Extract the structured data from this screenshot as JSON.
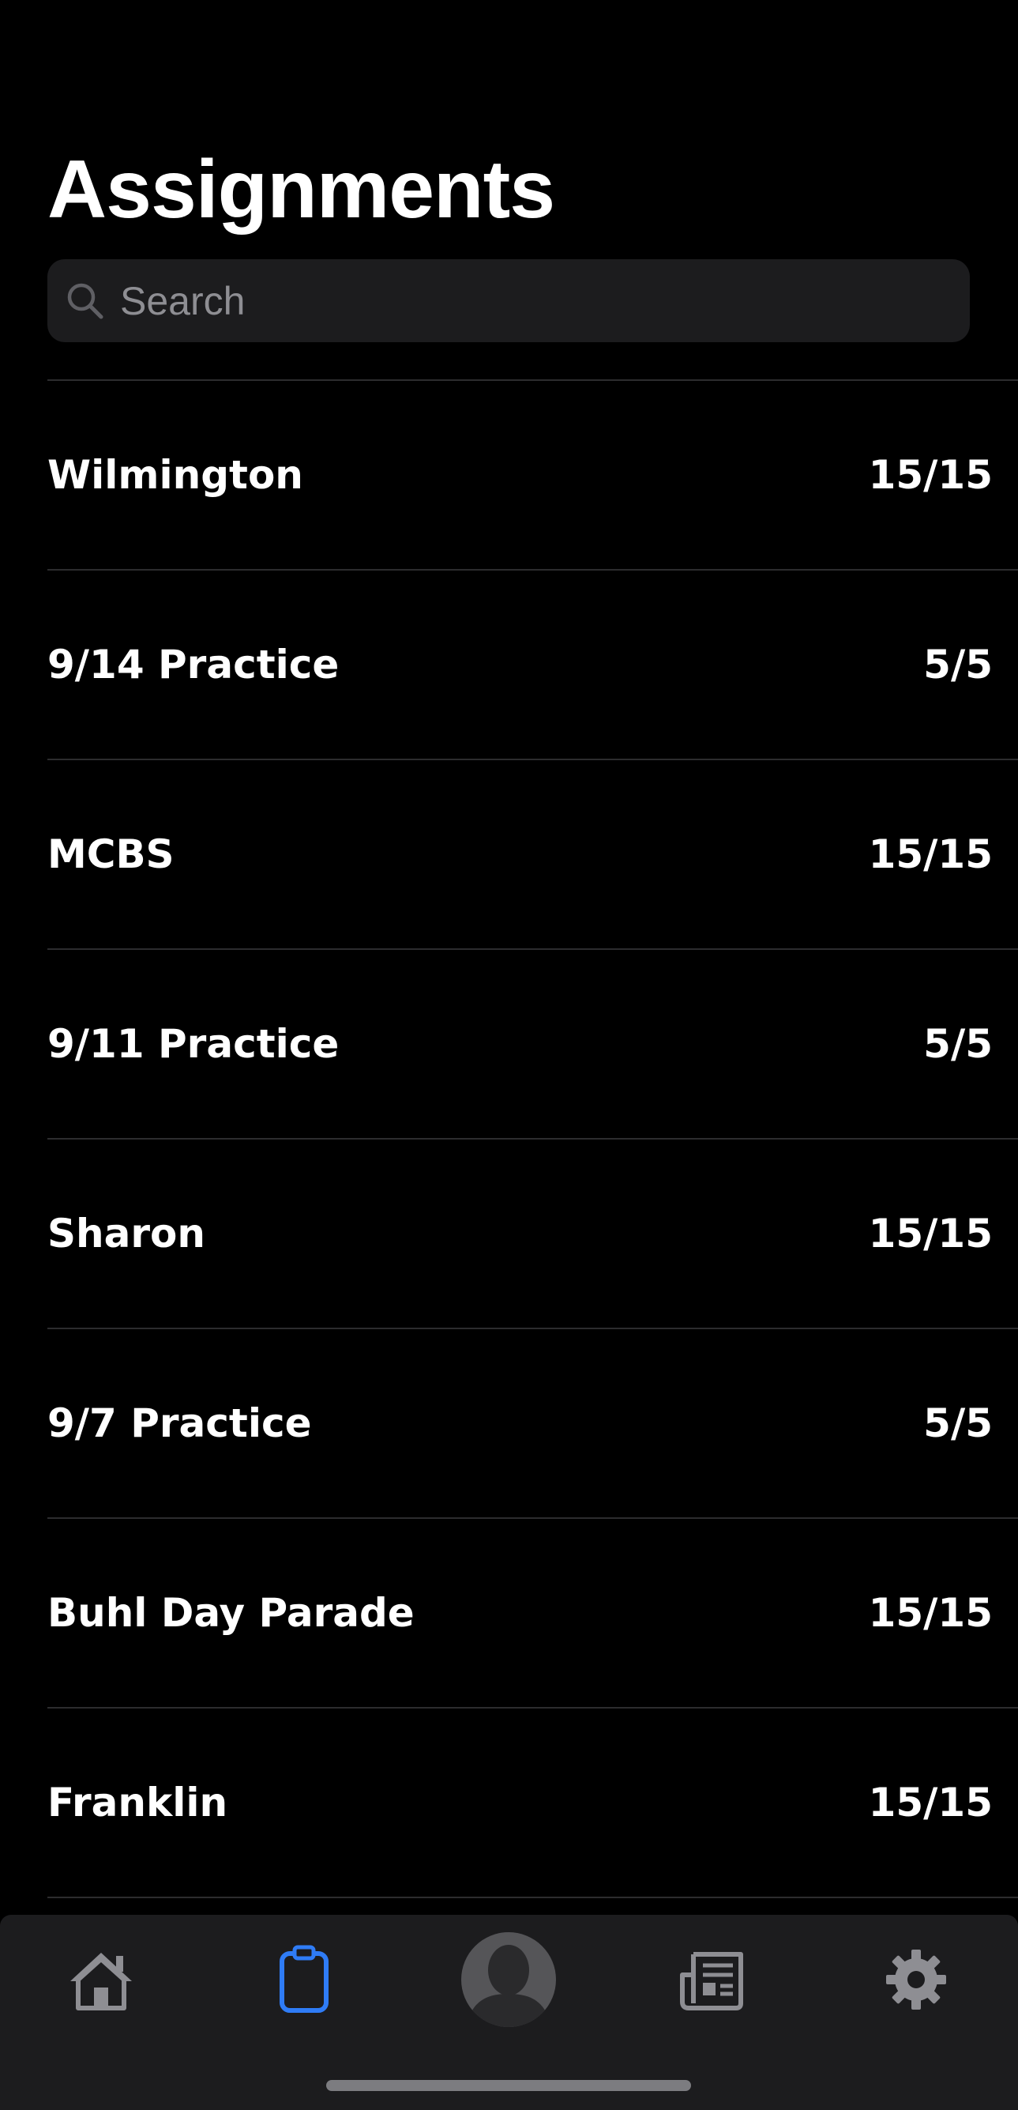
{
  "header": {
    "title": "Assignments"
  },
  "search": {
    "placeholder": "Search",
    "value": ""
  },
  "assignments": [
    {
      "name": "Wilmington",
      "score": "15/15"
    },
    {
      "name": "9/14 Practice",
      "score": "5/5"
    },
    {
      "name": "MCBS",
      "score": "15/15"
    },
    {
      "name": "9/11 Practice",
      "score": "5/5"
    },
    {
      "name": "Sharon",
      "score": "15/15"
    },
    {
      "name": "9/7 Practice",
      "score": "5/5"
    },
    {
      "name": "Buhl Day Parade",
      "score": "15/15"
    },
    {
      "name": "Franklin",
      "score": "15/15"
    }
  ],
  "tabbar": {
    "active_color": "#2f7cf6",
    "inactive_color": "#8e8e93",
    "tabs": [
      {
        "icon": "home-icon",
        "active": false
      },
      {
        "icon": "clipboard-icon",
        "active": true
      },
      {
        "icon": "avatar",
        "active": false
      },
      {
        "icon": "newspaper-icon",
        "active": false
      },
      {
        "icon": "gear-icon",
        "active": false
      }
    ]
  },
  "colors": {
    "background": "#000000",
    "surface": "#1c1c1e",
    "divider": "#2c2c2e",
    "text": "#ffffff"
  }
}
